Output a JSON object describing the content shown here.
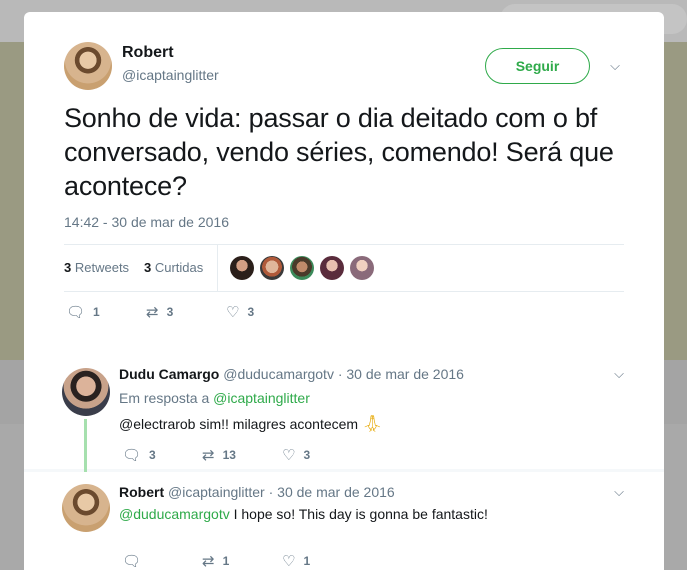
{
  "tweet": {
    "author_name": "Robert",
    "author_handle": "@icaptainglitter",
    "follow_label": "Seguir",
    "text": "Sonho de vida: passar o dia deitado com o bf conversado, vendo séries, comendo! Será que acontece?",
    "timestamp": "14:42 - 30 de mar de 2016",
    "retweets_count": "3",
    "retweets_label": "Retweets",
    "likes_count": "3",
    "likes_label": "Curtidas",
    "reply_count": "1",
    "retweet_action_count": "3",
    "like_action_count": "3"
  },
  "replies": [
    {
      "name": "Dudu Camargo",
      "handle": "@duducamargotv",
      "date": "· 30 de mar de 2016",
      "in_reply_prefix": "Em resposta a",
      "in_reply_handle": "@icaptainglitter",
      "text": "@electrarob sim!! milagres acontecem",
      "reply_count": "3",
      "retweet_count": "13",
      "like_count": "3"
    },
    {
      "name": "Robert",
      "handle": "@icaptainglitter",
      "date": "· 30 de mar de 2016",
      "mention": "@duducamargotv",
      "text": "I hope so! This day is gonna be fantastic!",
      "reply_count": "",
      "retweet_count": "1",
      "like_count": "1"
    }
  ],
  "icons": {
    "reply": "reply-icon",
    "retweet": "retweet-icon",
    "like": "heart-icon",
    "more": "chevron-down-icon",
    "emoji": "praying-hands-icon"
  },
  "colors": {
    "accent": "#2faa4a",
    "text": "#14171a",
    "muted": "#657786",
    "thread": "#a6e0ae"
  }
}
